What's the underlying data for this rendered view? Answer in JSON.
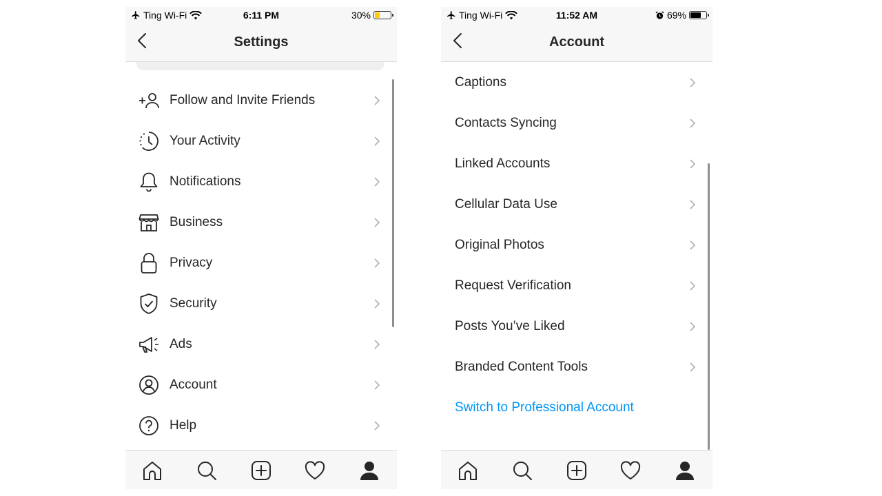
{
  "left_phone": {
    "status": {
      "carrier": "Ting Wi-Fi",
      "time": "6:11 PM",
      "battery_text": "30%",
      "battery_level": 0.3,
      "battery_color": "#ffcc00"
    },
    "nav": {
      "title": "Settings"
    },
    "items": [
      {
        "label": "Follow and Invite Friends",
        "icon": "add-person-icon"
      },
      {
        "label": "Your Activity",
        "icon": "activity-clock-icon"
      },
      {
        "label": "Notifications",
        "icon": "bell-icon"
      },
      {
        "label": "Business",
        "icon": "storefront-icon"
      },
      {
        "label": "Privacy",
        "icon": "lock-icon"
      },
      {
        "label": "Security",
        "icon": "shield-check-icon"
      },
      {
        "label": "Ads",
        "icon": "megaphone-icon"
      },
      {
        "label": "Account",
        "icon": "user-circle-icon"
      },
      {
        "label": "Help",
        "icon": "help-circle-icon"
      }
    ]
  },
  "right_phone": {
    "status": {
      "carrier": "Ting Wi-Fi",
      "time": "11:52 AM",
      "battery_text": "69%",
      "battery_level": 0.69,
      "battery_color": "#000000"
    },
    "nav": {
      "title": "Account"
    },
    "items": [
      {
        "label": "Captions"
      },
      {
        "label": "Contacts Syncing"
      },
      {
        "label": "Linked Accounts"
      },
      {
        "label": "Cellular Data Use"
      },
      {
        "label": "Original Photos"
      },
      {
        "label": "Request Verification"
      },
      {
        "label": "Posts You’ve Liked"
      },
      {
        "label": "Branded Content Tools"
      }
    ],
    "professional_link": "Switch to Professional Account"
  },
  "tabbar": [
    "home-icon",
    "search-icon",
    "new-post-icon",
    "activity-heart-icon",
    "profile-icon"
  ],
  "colors": {
    "link": "#0095f6",
    "text": "#262626",
    "chevron": "#b0b0b0"
  }
}
